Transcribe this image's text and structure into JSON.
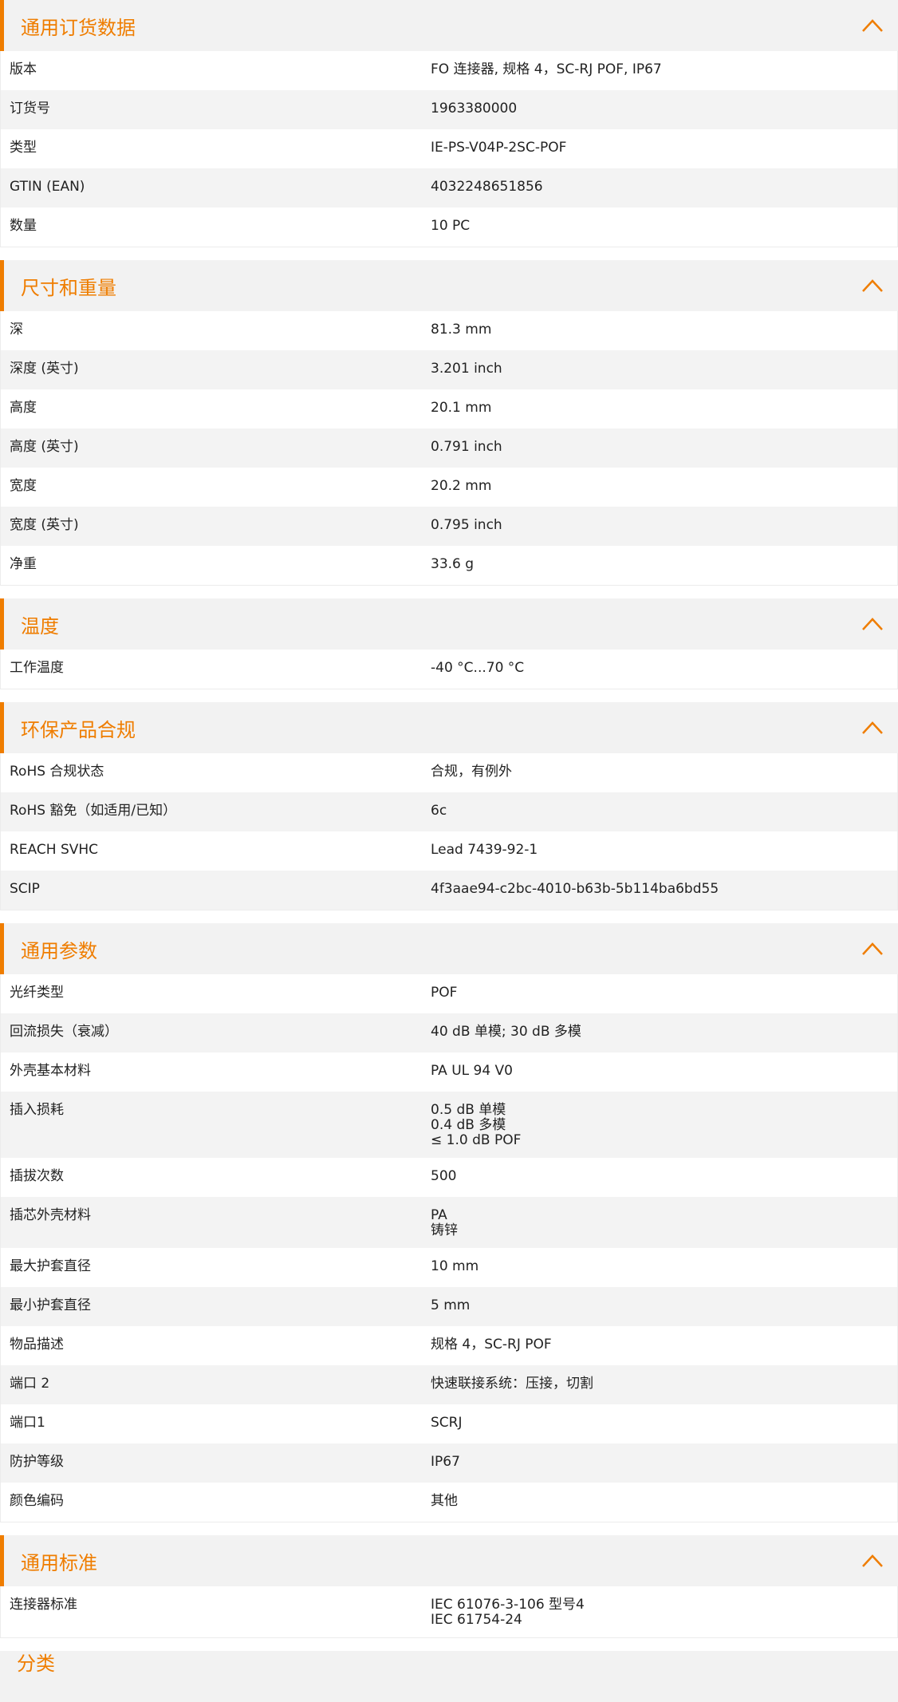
{
  "accent_color": "#ef7d00",
  "sections": [
    {
      "title": "通用订货数据",
      "rows": [
        {
          "label": "版本",
          "value": "FO 连接器, 规格 4，SC-RJ POF, IP67"
        },
        {
          "label": "订货号",
          "value": "1963380000"
        },
        {
          "label": "类型",
          "value": "IE-PS-V04P-2SC-POF"
        },
        {
          "label": "GTIN (EAN)",
          "value": "4032248651856"
        },
        {
          "label": "数量",
          "value": "10  PC"
        }
      ]
    },
    {
      "title": "尺寸和重量",
      "rows": [
        {
          "label": "深",
          "value": "81.3  mm"
        },
        {
          "label": "深度 (英寸)",
          "value": "3.201  inch"
        },
        {
          "label": "高度",
          "value": "20.1  mm"
        },
        {
          "label": "高度 (英寸)",
          "value": "0.791  inch"
        },
        {
          "label": "宽度",
          "value": "20.2  mm"
        },
        {
          "label": "宽度 (英寸)",
          "value": "0.795  inch"
        },
        {
          "label": "净重",
          "value": "33.6  g"
        }
      ]
    },
    {
      "title": "温度",
      "rows": [
        {
          "label": "工作温度",
          "value": "-40 °C...70 °C"
        }
      ]
    },
    {
      "title": "环保产品合规",
      "rows": [
        {
          "label": "RoHS 合规状态",
          "value": "合规，有例外"
        },
        {
          "label": "RoHS 豁免（如适用/已知）",
          "value": "6c"
        },
        {
          "label": "REACH SVHC",
          "value": "Lead 7439-92-1"
        },
        {
          "label": "SCIP",
          "value": "4f3aae94-c2bc-4010-b63b-5b114ba6bd55"
        }
      ]
    },
    {
      "title": "通用参数",
      "rows": [
        {
          "label": "光纤类型",
          "value": "POF"
        },
        {
          "label": "回流损失（衰减）",
          "value": "40 dB 单模; 30 dB 多模"
        },
        {
          "label": "外壳基本材料",
          "value": "PA UL 94 V0"
        },
        {
          "label": "插入损耗",
          "value": "0.5 dB 单模\n0.4 dB 多模\n≤ 1.0 dB POF"
        },
        {
          "label": "插拔次数",
          "value": "500"
        },
        {
          "label": "插芯外壳材料",
          "value": "PA\n铸锌"
        },
        {
          "label": "最大护套直径",
          "value": "10  mm"
        },
        {
          "label": "最小护套直径",
          "value": "5  mm"
        },
        {
          "label": "物品描述",
          "value": "规格 4，SC-RJ POF"
        },
        {
          "label": "端口 2",
          "value": "快速联接系统：压接，切割"
        },
        {
          "label": "端口1",
          "value": "SCRJ"
        },
        {
          "label": "防护等级",
          "value": "IP67"
        },
        {
          "label": "颜色编码",
          "value": "其他"
        }
      ]
    },
    {
      "title": "通用标准",
      "rows": [
        {
          "label": "连接器标准",
          "value": "IEC 61076-3-106 型号4\nIEC 61754-24"
        }
      ]
    }
  ],
  "next_section_partial_title": "分类"
}
